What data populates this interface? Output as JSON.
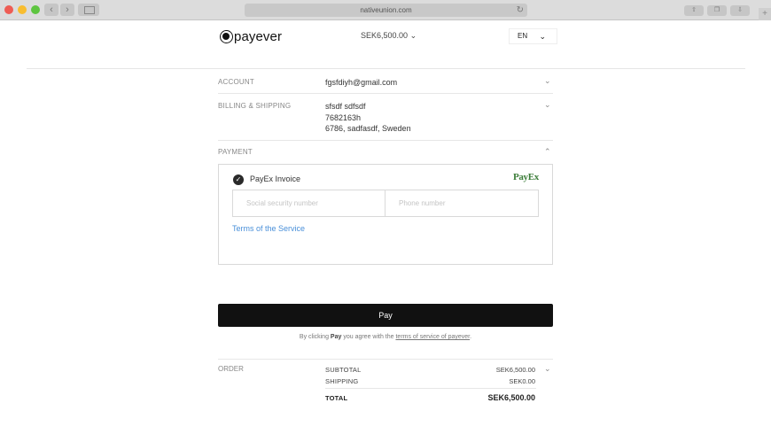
{
  "browser": {
    "url": "nativeunion.com"
  },
  "header": {
    "brand": "payever",
    "amount": "SEK6,500.00",
    "language": "EN"
  },
  "sections": {
    "account": {
      "label": "ACCOUNT",
      "value": "fgsfdiyh@gmail.com"
    },
    "billing": {
      "label": "BILLING & SHIPPING",
      "lines": [
        "sfsdf sdfsdf",
        "7682163h",
        "6786, sadfasdf, Sweden"
      ]
    },
    "payment": {
      "label": "PAYMENT",
      "method_label": "PayEx Invoice",
      "provider_logo": "PayEx",
      "ssn_placeholder": "Social security number",
      "phone_placeholder": "Phone number",
      "terms_link": "Terms of the Service"
    }
  },
  "pay": {
    "button_label": "Pay",
    "consent_prefix": "By clicking ",
    "consent_bold": "Pay",
    "consent_middle": " you agree with the ",
    "consent_link": "terms of service of payever",
    "consent_suffix": "."
  },
  "order": {
    "label": "ORDER",
    "subtotal_label": "SUBTOTAL",
    "subtotal_value": "SEK6,500.00",
    "shipping_label": "SHIPPING",
    "shipping_value": "SEK0.00",
    "total_label": "TOTAL",
    "total_value": "SEK6,500.00"
  },
  "colors": {
    "link": "#4a90d9",
    "payex_green": "#3c7d39",
    "button_bg": "#111111"
  }
}
